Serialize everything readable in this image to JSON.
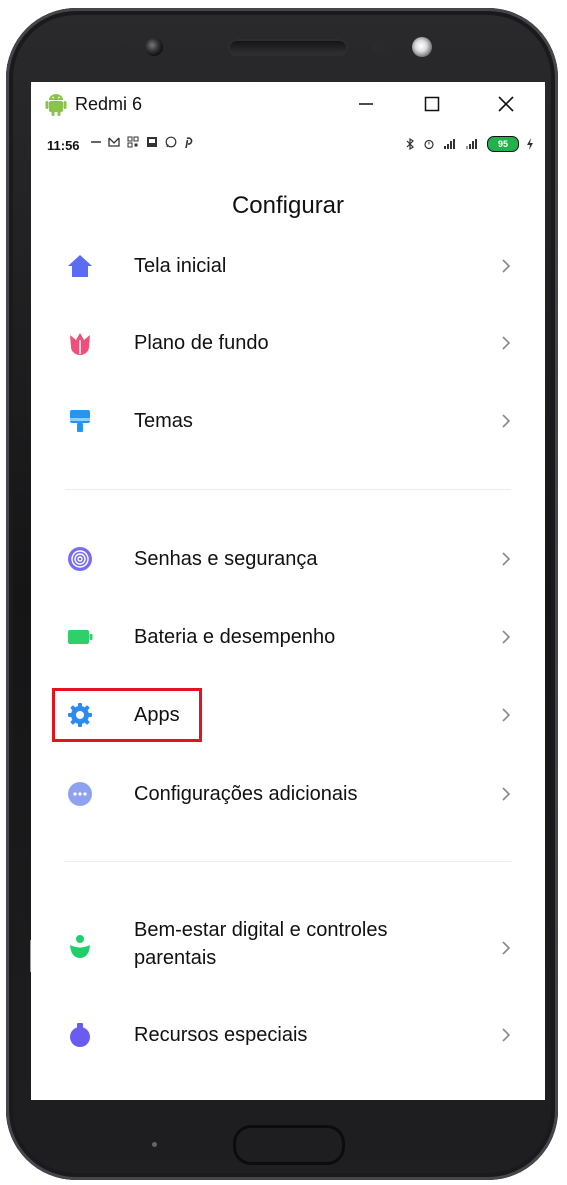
{
  "window": {
    "title": "Redmi 6",
    "minimize_label": "—",
    "maximize_label": "☐",
    "close_label": "✕"
  },
  "statusbar": {
    "time": "11:56",
    "battery": "95"
  },
  "page": {
    "title": "Configurar"
  },
  "menu": {
    "items": [
      {
        "label": "Tela inicial",
        "icon": "home-icon"
      },
      {
        "label": "Plano de fundo",
        "icon": "wallpaper-flower-icon"
      },
      {
        "label": "Temas",
        "icon": "themes-brush-icon"
      },
      {
        "label": "Senhas e segurança",
        "icon": "fingerprint-icon"
      },
      {
        "label": "Bateria e desempenho",
        "icon": "battery-icon"
      },
      {
        "label": "Apps",
        "icon": "gear-icon"
      },
      {
        "label": "Configurações adicionais",
        "icon": "more-dots-icon"
      },
      {
        "label": "Bem-estar digital e controles\nparentais",
        "icon": "digital-wellbeing-icon"
      },
      {
        "label": "Recursos especiais",
        "icon": "special-features-icon"
      }
    ]
  },
  "colors": {
    "highlight": "#e11420",
    "home": "#5b6cf0",
    "wallpaper": "#ef4f7a",
    "themes": "#2196f3",
    "fingerprint": "#7a6cf0",
    "battery": "#2fcf6a",
    "apps": "#2d8cf0",
    "more": "#8ea2f0",
    "wellbeing": "#1fcf6a",
    "special": "#6a5cf0"
  }
}
